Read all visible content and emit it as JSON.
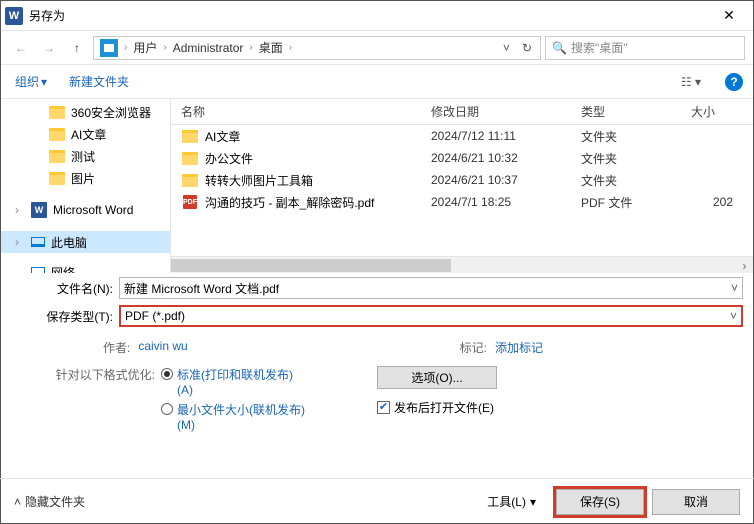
{
  "window": {
    "title": "另存为"
  },
  "breadcrumb": {
    "p1": "用户",
    "p2": "Administrator",
    "p3": "桌面"
  },
  "search": {
    "placeholder": "搜索\"桌面\""
  },
  "toolbar": {
    "organize": "组织",
    "newfolder": "新建文件夹"
  },
  "columns": {
    "name": "名称",
    "date": "修改日期",
    "type": "类型",
    "size": "大小"
  },
  "sidebar": {
    "i0": "360安全浏览器",
    "i1": "AI文章",
    "i2": "测试",
    "i3": "图片",
    "word": "Microsoft Word",
    "pc": "此电脑",
    "net": "网络"
  },
  "files": {
    "f0": {
      "name": "AI文章",
      "date": "2024/7/12 11:11",
      "type": "文件夹",
      "size": ""
    },
    "f1": {
      "name": "办公文件",
      "date": "2024/6/21 10:32",
      "type": "文件夹",
      "size": ""
    },
    "f2": {
      "name": "转转大师图片工具箱",
      "date": "2024/6/21 10:37",
      "type": "文件夹",
      "size": ""
    },
    "f3": {
      "name": "沟通的技巧 - 副本_解除密码.pdf",
      "date": "2024/7/1 18:25",
      "type": "PDF 文件",
      "size": "202"
    }
  },
  "form": {
    "filename_label": "文件名(N):",
    "filename_value": "新建 Microsoft Word 文档.pdf",
    "filetype_label": "保存类型(T):",
    "filetype_value": "PDF (*.pdf)",
    "author_label": "作者:",
    "author_value": "caivin wu",
    "tags_label": "标记:",
    "tags_value": "添加标记",
    "optimize_label": "针对以下格式优化:",
    "opt_standard": "标准(打印和联机发布)(A)",
    "opt_min": "最小文件大小(联机发布)(M)",
    "options_btn": "选项(O)...",
    "openafter": "发布后打开文件(E)"
  },
  "footer": {
    "hidefolders": "隐藏文件夹",
    "tools": "工具(L)",
    "save": "保存(S)",
    "cancel": "取消"
  }
}
